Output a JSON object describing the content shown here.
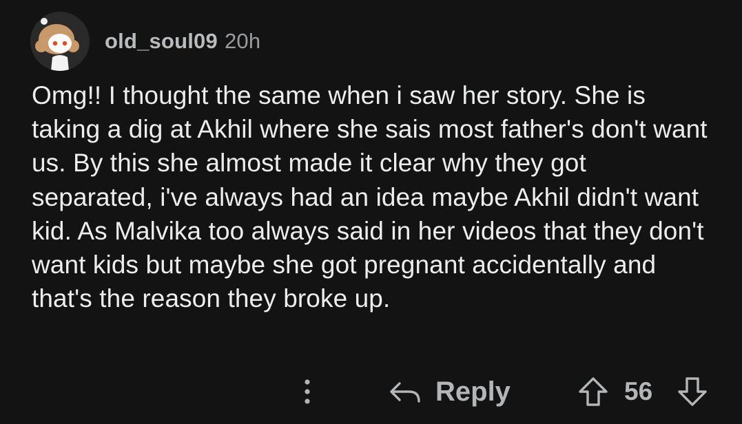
{
  "comment": {
    "author": {
      "username": "old_soul09",
      "avatar_icon": "snoo-avatar-icon"
    },
    "timestamp": "20h",
    "body": "Omg!! I thought the same when i saw her story. She is taking a dig at Akhil where she sais most father's don't want us. By this she almost made it clear why they got separated, i've always had an idea maybe Akhil didn't want kid. As Malvika too always said in her videos that they don't want kids but maybe she got pregnant accidentally and that's the reason they broke up."
  },
  "actions": {
    "more_icon": "more-vertical-icon",
    "reply_icon": "reply-arrow-icon",
    "reply_label": "Reply",
    "upvote_icon": "upvote-arrow-icon",
    "vote_count": "56",
    "downvote_icon": "downvote-arrow-icon"
  },
  "colors": {
    "background": "#131313",
    "text": "#ecedee",
    "muted": "#b3b6b8"
  }
}
